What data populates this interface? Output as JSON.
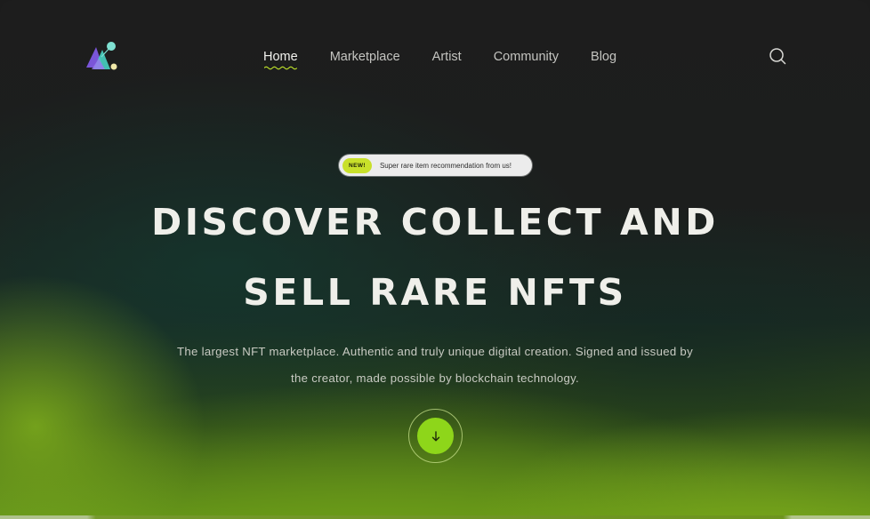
{
  "nav": {
    "items": [
      {
        "label": "Home",
        "active": true
      },
      {
        "label": "Marketplace",
        "active": false
      },
      {
        "label": "Artist",
        "active": false
      },
      {
        "label": "Community",
        "active": false
      },
      {
        "label": "Blog",
        "active": false
      }
    ],
    "search_icon": "search-icon",
    "logo_icon": "triangles-logo-icon"
  },
  "badge": {
    "tag": "NEW!",
    "text": "Super rare item recommendation from us!"
  },
  "hero": {
    "headline_line1": "DISCOVER COLLECT AND",
    "headline_line2": "SELL RARE NFTS",
    "subtitle_line1": "The largest NFT marketplace. Authentic and truly unique digital creation. Signed and issued by",
    "subtitle_line2": "the creator, made possible by blockchain technology."
  },
  "scroll_button": {
    "icon": "arrow-down-icon"
  },
  "colors": {
    "accent": "#8ed61a",
    "badge_tag": "#c8e02a",
    "background": "#1c1c1c"
  }
}
